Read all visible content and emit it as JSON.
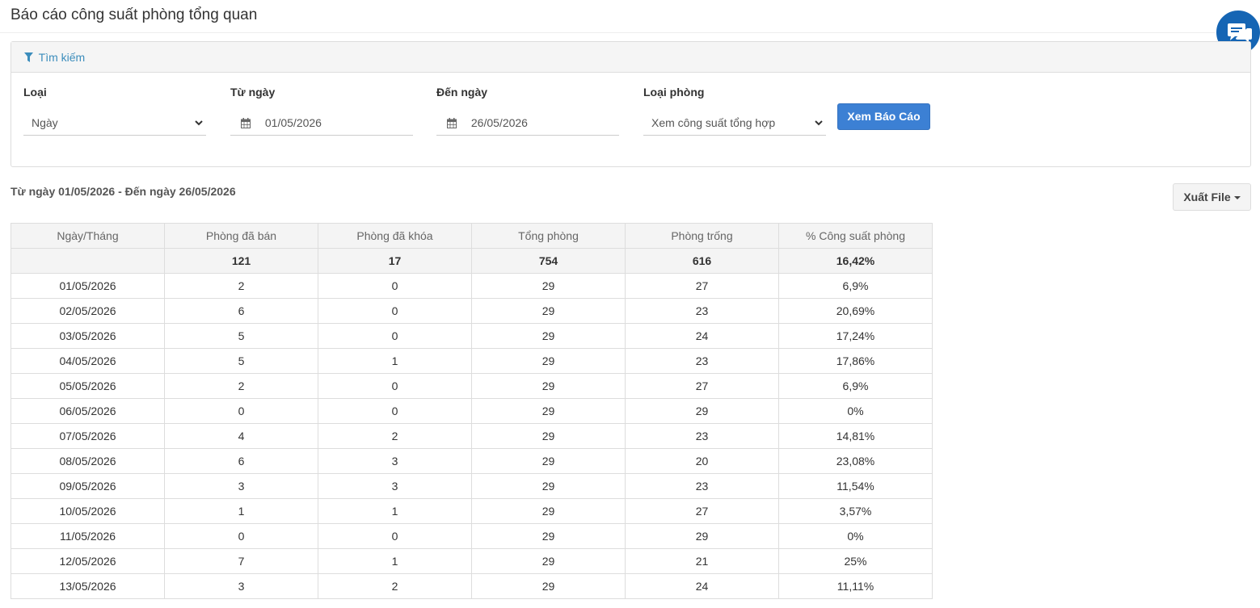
{
  "header": {
    "title": "Báo cáo công suất phòng tổng quan"
  },
  "search": {
    "title": "Tìm kiếm",
    "fields": {
      "type": {
        "label": "Loại",
        "value": "Ngày"
      },
      "from": {
        "label": "Từ ngày",
        "value": "01/05/2026"
      },
      "to": {
        "label": "Đến ngày",
        "value": "26/05/2026"
      },
      "room_type": {
        "label": "Loại phòng",
        "value": "Xem công suất tổng hợp"
      }
    },
    "view_button": "Xem Báo Cáo"
  },
  "report": {
    "range_text": "Từ ngày 01/05/2026 - Đến ngày 26/05/2026",
    "export_button": "Xuất File",
    "columns": [
      "Ngày/Tháng",
      "Phòng đã bán",
      "Phòng đã khóa",
      "Tổng phòng",
      "Phòng trống",
      "% Công suất phòng"
    ],
    "totals": [
      "",
      "121",
      "17",
      "754",
      "616",
      "16,42%"
    ],
    "rows": [
      [
        "01/05/2026",
        "2",
        "0",
        "29",
        "27",
        "6,9%"
      ],
      [
        "02/05/2026",
        "6",
        "0",
        "29",
        "23",
        "20,69%"
      ],
      [
        "03/05/2026",
        "5",
        "0",
        "29",
        "24",
        "17,24%"
      ],
      [
        "04/05/2026",
        "5",
        "1",
        "29",
        "23",
        "17,86%"
      ],
      [
        "05/05/2026",
        "2",
        "0",
        "29",
        "27",
        "6,9%"
      ],
      [
        "06/05/2026",
        "0",
        "0",
        "29",
        "29",
        "0%"
      ],
      [
        "07/05/2026",
        "4",
        "2",
        "29",
        "23",
        "14,81%"
      ],
      [
        "08/05/2026",
        "6",
        "3",
        "29",
        "20",
        "23,08%"
      ],
      [
        "09/05/2026",
        "3",
        "3",
        "29",
        "23",
        "11,54%"
      ],
      [
        "10/05/2026",
        "1",
        "1",
        "29",
        "27",
        "3,57%"
      ],
      [
        "11/05/2026",
        "0",
        "0",
        "29",
        "29",
        "0%"
      ],
      [
        "12/05/2026",
        "7",
        "1",
        "29",
        "21",
        "25%"
      ],
      [
        "13/05/2026",
        "3",
        "2",
        "29",
        "24",
        "11,11%"
      ]
    ]
  },
  "icons": {
    "filter": "filter-icon",
    "calendar": "calendar-icon",
    "chevron": "chevron-down-icon",
    "chat": "chat-icon"
  },
  "colors": {
    "accent": "#3c8dbc",
    "primary_button": "#3c80d4",
    "chat": "#1565b4"
  }
}
